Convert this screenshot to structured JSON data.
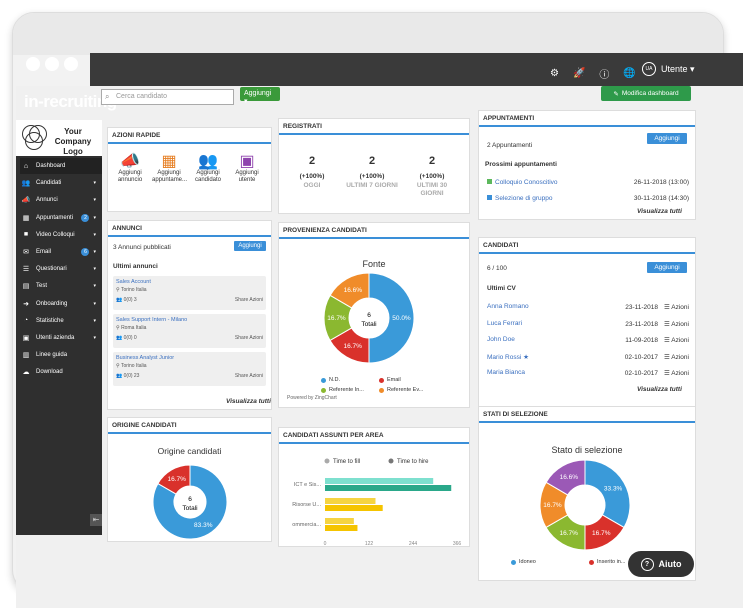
{
  "app": {
    "logo": "in-recruiting",
    "search_placeholder": "Cerca candidato",
    "add_label": "Aggiungi ▾",
    "user_initials": "UA",
    "user_name": "Utente ▾",
    "modify_dashboard": "Modifica dashboard"
  },
  "company": {
    "name": "Your Company Logo"
  },
  "sidebar": {
    "items": [
      {
        "label": "Dashboard",
        "icon": "home-icon",
        "glyph": "⌂"
      },
      {
        "label": "Candidati",
        "icon": "users-icon",
        "glyph": "👥"
      },
      {
        "label": "Annunci",
        "icon": "megaphone-icon",
        "glyph": "📣"
      },
      {
        "label": "Appuntamenti",
        "icon": "calendar-icon",
        "glyph": "▦",
        "badge": "2"
      },
      {
        "label": "Video Colloqui",
        "icon": "video-icon",
        "glyph": "■"
      },
      {
        "label": "Email",
        "icon": "mail-icon",
        "glyph": "✉",
        "badge": "6"
      },
      {
        "label": "Questionari",
        "icon": "list-icon",
        "glyph": "☰"
      },
      {
        "label": "Test",
        "icon": "test-icon",
        "glyph": "▤"
      },
      {
        "label": "Onboarding",
        "icon": "onboarding-icon",
        "glyph": "➜"
      },
      {
        "label": "Statistiche",
        "icon": "pie-icon",
        "glyph": "◔"
      },
      {
        "label": "Utenti azienda",
        "icon": "user-id-icon",
        "glyph": "▣"
      },
      {
        "label": "Linee guida",
        "icon": "book-icon",
        "glyph": "▥"
      },
      {
        "label": "Download",
        "icon": "download-icon",
        "glyph": "☁"
      }
    ]
  },
  "quick": {
    "title": "Azioni rapide",
    "items": [
      {
        "label": "Aggiungi annuncio",
        "glyph": "📣",
        "color": "#3a8fd8"
      },
      {
        "label": "Aggiungi appuntame...",
        "glyph": "▦",
        "color": "#e67e22"
      },
      {
        "label": "Aggiungi candidato",
        "glyph": "👥",
        "color": "#5cb85c"
      },
      {
        "label": "Aggiungi utente",
        "glyph": "▣",
        "color": "#8e44ad"
      }
    ]
  },
  "registrati": {
    "title": "Registrati",
    "stats": [
      {
        "num": "2",
        "pct": "(+100%)",
        "label": "OGGI"
      },
      {
        "num": "2",
        "pct": "(+100%)",
        "label": "ULTIMI 7 GIORNI"
      },
      {
        "num": "2",
        "pct": "(+100%)",
        "label": "ULTIMI 30 GIORNI"
      }
    ]
  },
  "appuntamenti": {
    "title": "Appuntamenti",
    "count": "2 Appuntamenti",
    "add": "Aggiungi",
    "next": "Prossimi appuntamenti",
    "items": [
      {
        "name": "Colloquio Conoscitivo",
        "date": "26-11-2018 (13:00)",
        "color": "#5cb85c"
      },
      {
        "name": "Selezione di gruppo",
        "date": "30-11-2018 (14:30)",
        "color": "#3a8fd8"
      }
    ],
    "all": "Visualizza tutti"
  },
  "annunci": {
    "title": "Annunci",
    "count": "3 Annunci pubblicati",
    "add": "Aggiungi",
    "latest": "Ultimi annunci",
    "items": [
      {
        "title": "Sales Account",
        "loc": "Torino Italia",
        "meta": "0(0)  3",
        "share": "Share  Azioni"
      },
      {
        "title": "Sales Support Intern - Milano",
        "loc": "Roma Italia",
        "meta": "0(0)  0",
        "share": "Share  Azioni"
      },
      {
        "title": "Business Analyst Junior",
        "loc": "Torino Italia",
        "meta": "0(0)  23",
        "share": "Share  Azioni"
      }
    ],
    "all": "Visualizza tutti"
  },
  "provenienza": {
    "title": "Provenienza candidati",
    "chart_title": "Fonte",
    "center_num": "6",
    "center_lbl": "Totali",
    "legend": [
      {
        "label": "N.D.",
        "color": "#3a9ad9"
      },
      {
        "label": "Email",
        "color": "#d9312b"
      },
      {
        "label": "Referente In...",
        "color": "#8bb830"
      },
      {
        "label": "Referente Ev...",
        "color": "#f08c2a"
      }
    ],
    "powered": "Powered by ZingChart"
  },
  "candidati": {
    "title": "Candidati",
    "count": "6 / 100",
    "add": "Aggiungi",
    "latest": "Ultimi CV",
    "items": [
      {
        "name": "Anna Romano",
        "date": "23-11-2018",
        "act": "Azioni"
      },
      {
        "name": "Luca Ferrari",
        "date": "23-11-2018",
        "act": "Azioni"
      },
      {
        "name": "John Doe",
        "date": "11-09-2018",
        "act": "Azioni"
      },
      {
        "name": "Mario Rossi ★",
        "date": "02-10-2017",
        "act": "Azioni"
      },
      {
        "name": "Maria Bianca",
        "date": "02-10-2017",
        "act": "Azioni"
      }
    ],
    "all": "Visualizza tutti"
  },
  "origine": {
    "title": "Origine candidati",
    "chart_title": "Origine candidati",
    "center_num": "6",
    "center_lbl": "Totali"
  },
  "assunti": {
    "title": "Candidati assunti per area",
    "legend": [
      "Time to fill",
      "Time to hire"
    ],
    "cats": [
      "ICT e Sis...",
      "Risorse U...",
      "ommercia..."
    ],
    "ticks": [
      "0",
      "122",
      "244",
      "366"
    ]
  },
  "stati": {
    "title": "Stati di selezione",
    "chart_title": "Stato di selezione",
    "legend": [
      "Idoneo",
      "Inserito in..."
    ]
  },
  "help": {
    "label": "Aiuto"
  },
  "chart_data": [
    {
      "type": "pie",
      "title": "Fonte",
      "series": [
        {
          "values": [
            50.0,
            16.7,
            16.7,
            16.6
          ]
        }
      ],
      "categories": [
        "N.D.",
        "Email",
        "Referente In...",
        "Referente Ev..."
      ],
      "labels": [
        "50.0%",
        "16.7%",
        "16.7%",
        "16.6%"
      ]
    },
    {
      "type": "pie",
      "title": "Origine candidati",
      "categories": [
        "A",
        "B"
      ],
      "values": [
        83.3,
        16.7
      ],
      "labels": [
        "83.3%",
        "16.7%"
      ]
    },
    {
      "type": "bar",
      "categories": [
        "ICT e Sis...",
        "Risorse U...",
        "ommercia..."
      ],
      "series": [
        {
          "name": "Time to fill",
          "values": [
            300,
            140,
            80
          ]
        },
        {
          "name": "Time to hire",
          "values": [
            350,
            160,
            90
          ]
        }
      ],
      "xlim": [
        0,
        366
      ]
    },
    {
      "type": "pie",
      "title": "Stato di selezione",
      "values": [
        33.3,
        16.7,
        16.7,
        16.7,
        16.6
      ],
      "labels": [
        "33.3%",
        "16.7%",
        "16.7%",
        "16.7%",
        "16.6%"
      ]
    }
  ]
}
